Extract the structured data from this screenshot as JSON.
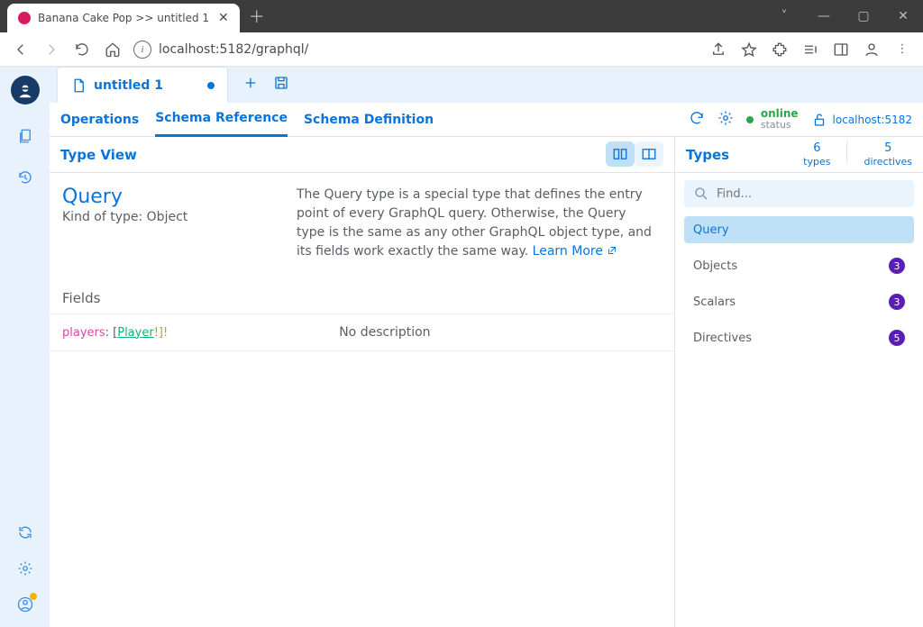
{
  "window": {
    "title": "Banana Cake Pop >> untitled 1"
  },
  "browser": {
    "url": "localhost:5182/graphql/",
    "icons": {
      "back": "←",
      "forward": "→",
      "reload": "↻",
      "home": "⌂",
      "share": "⇪",
      "star": "☆",
      "ext": "✦",
      "media": "♪",
      "panel": "▣",
      "user": "◎",
      "menu": "⋮"
    }
  },
  "doc_tab": {
    "label": "untitled 1",
    "dirty": true
  },
  "nav_tabs": [
    "Operations",
    "Schema Reference",
    "Schema Definition"
  ],
  "nav_active": 1,
  "status": {
    "label": "online",
    "sub": "status"
  },
  "host": "localhost:5182",
  "type_view": {
    "title": "Type View"
  },
  "type_detail": {
    "name": "Query",
    "kind": "Kind of type: Object",
    "desc": "The Query type is a special type that defines the entry point of every GraphQL query. Otherwise, the Query type is the same as any other GraphQL object type, and its fields work exactly the same way. ",
    "learn_more": "Learn More"
  },
  "fields_header": "Fields",
  "field": {
    "name": "players",
    "colon": ": [",
    "type": "Player",
    "mods": "!]!",
    "desc": "No description"
  },
  "types_panel": {
    "title": "Types",
    "stats_types_n": "6",
    "stats_types_l": "types",
    "stats_dirs_n": "5",
    "stats_dirs_l": "directives",
    "search_placeholder": "Find...",
    "items": [
      {
        "label": "Query",
        "count": null
      },
      {
        "label": "Objects",
        "count": "3"
      },
      {
        "label": "Scalars",
        "count": "3"
      },
      {
        "label": "Directives",
        "count": "5"
      }
    ],
    "active": 0
  }
}
